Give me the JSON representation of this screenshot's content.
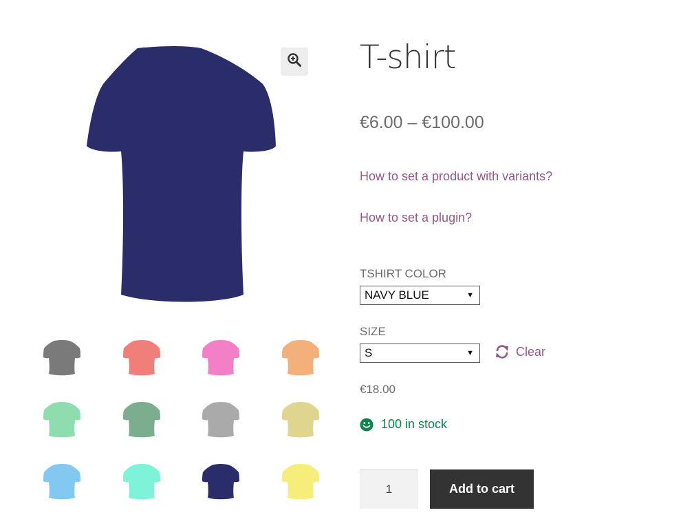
{
  "product": {
    "title": "T-shirt",
    "price_range": "€6.00 – €100.00",
    "main_image_color": "#2b2d6b"
  },
  "links": [
    "How to set a product with variants?",
    "How to set a plugin?"
  ],
  "variations": {
    "color_label": "TSHIRT COLOR",
    "color_value": "NAVY BLUE",
    "size_label": "SIZE",
    "size_value": "S",
    "clear_label": "Clear"
  },
  "variation_price": "€18.00",
  "stock": "100 in stock",
  "cart": {
    "quantity": "1",
    "button_label": "Add to cart"
  },
  "thumbnails": [
    {
      "color": "#7a7a7a"
    },
    {
      "color": "#f07f7a"
    },
    {
      "color": "#f37fc6"
    },
    {
      "color": "#f3b07a"
    },
    {
      "color": "#8fdcae"
    },
    {
      "color": "#7aae8f"
    },
    {
      "color": "#aaaaaa"
    },
    {
      "color": "#dfd58f"
    },
    {
      "color": "#82c8f0"
    },
    {
      "color": "#7ff2da"
    },
    {
      "color": "#2b2d6b"
    },
    {
      "color": "#f6ee7a"
    }
  ],
  "colors": {
    "link": "#96588a",
    "stock": "#0f834d",
    "button": "#333333"
  },
  "icons": {
    "zoom": "zoom-in-icon",
    "clear": "refresh-icon",
    "stock": "smile-icon"
  }
}
